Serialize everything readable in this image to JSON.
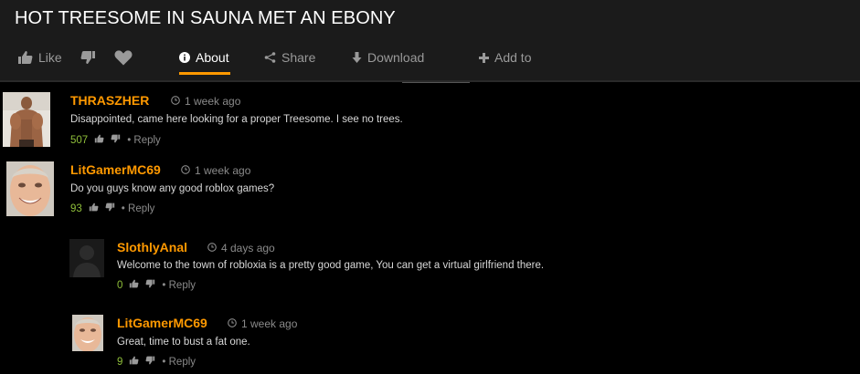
{
  "video": {
    "title": "HOT TREESOME IN SAUNA MET AN EBONY"
  },
  "actions": {
    "like": "Like",
    "about": "About",
    "share": "Share",
    "download": "Download",
    "add_to": "Add to"
  },
  "colors": {
    "accent": "#ff9900",
    "vote_green": "#8fbf3a"
  },
  "comments": [
    {
      "user": "THRASZHER",
      "time": "1 week ago",
      "text": "Disappointed, came here looking for a proper Treesome. I see no trees.",
      "votes": "507",
      "reply": "• Reply"
    },
    {
      "user": "LitGamerMC69",
      "time": "1 week ago",
      "text": "Do you guys know any good roblox games?",
      "votes": "93",
      "reply": "• Reply"
    },
    {
      "user": "SlothlyAnal",
      "time": "4 days ago",
      "text": "Welcome to the town of robloxia is a pretty good game, You can get a virtual girlfriend there.",
      "votes": "0",
      "reply": "• Reply"
    },
    {
      "user": "LitGamerMC69",
      "time": "1 week ago",
      "text": "Great, time to bust a fat one.",
      "votes": "9",
      "reply": "• Reply"
    }
  ]
}
